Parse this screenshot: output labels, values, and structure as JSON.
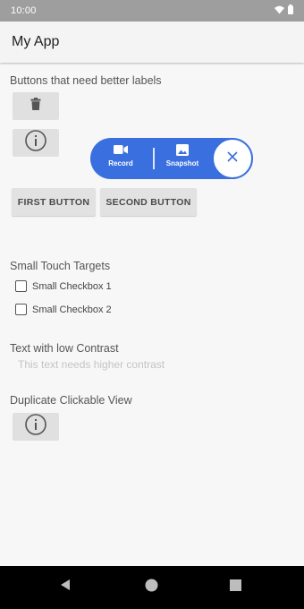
{
  "status_bar": {
    "time": "10:00",
    "icons": [
      "wifi-icon",
      "battery-icon"
    ]
  },
  "app_bar": {
    "title": "My App"
  },
  "sections": {
    "labels": {
      "title": "Buttons that need better labels"
    },
    "buttons": {
      "first": "FIRST BUTTON",
      "second": "SECOND BUTTON"
    },
    "touch": {
      "title": "Small Touch Targets",
      "checkbox1": "Small Checkbox 1",
      "checkbox2": "Small Checkbox 2"
    },
    "contrast": {
      "title": "Text with low Contrast",
      "text": "This text needs higher contrast"
    },
    "duplicate": {
      "title": "Duplicate Clickable View"
    }
  },
  "overlay": {
    "record_label": "Record",
    "snapshot_label": "Snapshot",
    "accent": "#3a6fe0"
  },
  "nav": {
    "icons": [
      "back-icon",
      "home-icon",
      "recents-icon"
    ]
  }
}
